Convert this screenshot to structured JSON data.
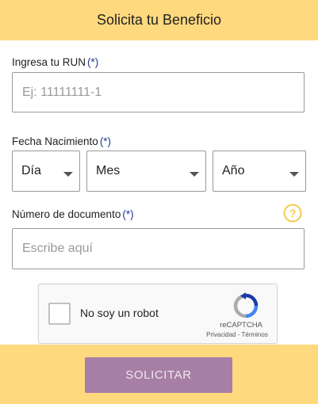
{
  "header": {
    "title": "Solicita tu Beneficio"
  },
  "form": {
    "required_marker": "(*)",
    "run": {
      "label": "Ingresa tu RUN",
      "placeholder": "Ej: 11111111-1"
    },
    "birthdate": {
      "label": "Fecha Nacimiento",
      "day": "Día",
      "month": "Mes",
      "year": "Año"
    },
    "document": {
      "label": "Número de documento",
      "placeholder": "Escribe aquí"
    }
  },
  "captcha": {
    "label": "No soy un robot",
    "brand": "reCAPTCHA",
    "privacy": "Privacidad",
    "separator": " - ",
    "terms": "Términos"
  },
  "footer": {
    "submit_label": "SOLICITAR"
  },
  "colors": {
    "header_bg": "#ffd97d",
    "button_bg": "#a77fa6",
    "required": "#1f3a93",
    "help_icon": "#f7c948"
  }
}
